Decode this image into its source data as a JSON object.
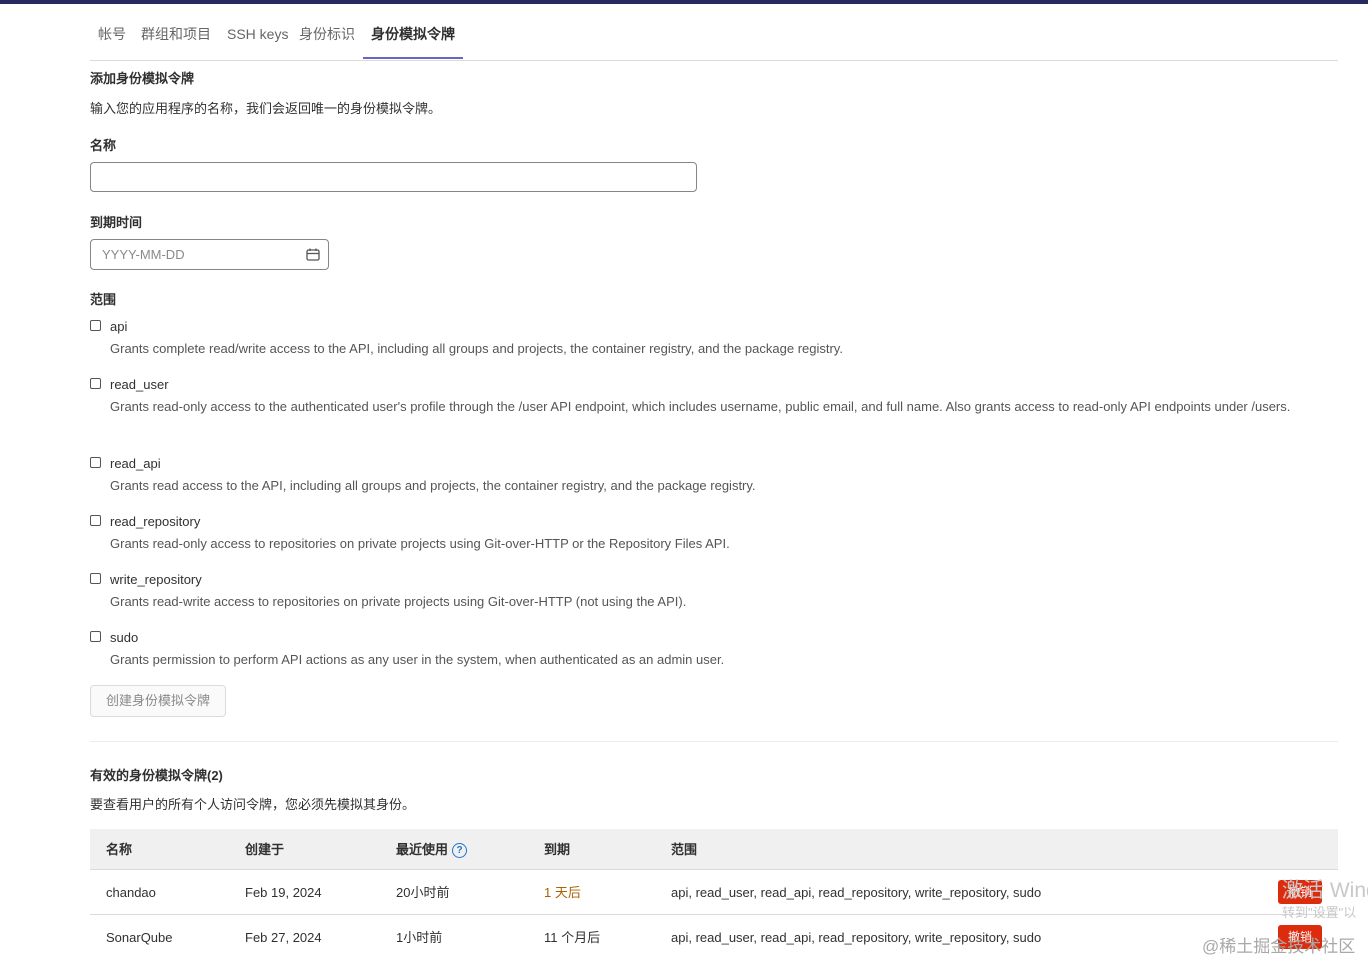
{
  "tabs": [
    {
      "label": "帐号",
      "active": false
    },
    {
      "label": "群组和项目",
      "active": false
    },
    {
      "label": "SSH keys",
      "active": false
    },
    {
      "label": "身份标识",
      "active": false
    },
    {
      "label": "身份模拟令牌",
      "active": true
    }
  ],
  "add_section": {
    "title": "添加身份模拟令牌",
    "description": "输入您的应用程序的名称，我们会返回唯一的身份模拟令牌。",
    "name_label": "名称",
    "name_value": "",
    "expiry_label": "到期时间",
    "expiry_placeholder": "YYYY-MM-DD",
    "calendar_icon": "calendar-icon",
    "scope_label": "范围",
    "create_button": "创建身份模拟令牌"
  },
  "scopes": [
    {
      "name": "api",
      "checked": false,
      "description": "Grants complete read/write access to the API, including all groups and projects, the container registry, and the package registry."
    },
    {
      "name": "read_user",
      "checked": false,
      "description": "Grants read-only access to the authenticated user's profile through the /user API endpoint, which includes username, public email, and full name. Also grants access to read-only API endpoints under /users."
    },
    {
      "name": "read_api",
      "checked": false,
      "description": "Grants read access to the API, including all groups and projects, the container registry, and the package registry."
    },
    {
      "name": "read_repository",
      "checked": false,
      "description": "Grants read-only access to repositories on private projects using Git-over-HTTP or the Repository Files API."
    },
    {
      "name": "write_repository",
      "checked": false,
      "description": "Grants read-write access to repositories on private projects using Git-over-HTTP (not using the API)."
    },
    {
      "name": "sudo",
      "checked": false,
      "description": "Grants permission to perform API actions as any user in the system, when authenticated as an admin user."
    }
  ],
  "active_section": {
    "title": "有效的身份模拟令牌(2)",
    "description": "要查看用户的所有个人访问令牌，您必须先模拟其身份。",
    "columns": {
      "name": "名称",
      "created": "创建于",
      "last_used": "最近使用",
      "expires": "到期",
      "scopes": "范围"
    },
    "help_icon": "question-circle-icon",
    "rows": [
      {
        "name": "chandao",
        "created": "Feb 19, 2024",
        "last_used": "20小时前",
        "expires": "1 天后",
        "expires_warning": true,
        "scopes": "api, read_user, read_api, read_repository, write_repository, sudo",
        "revoke": "撤销"
      },
      {
        "name": "SonarQube",
        "created": "Feb 27, 2024",
        "last_used": "1小时前",
        "expires": "11 个月后",
        "expires_warning": false,
        "scopes": "api, read_user, read_api, read_repository, write_repository, sudo",
        "revoke": "撤销"
      }
    ]
  },
  "overlay": {
    "win_line1": "激活 Wind",
    "win_line2": "转到\"设置\"以",
    "watermark": "@稀土掘金技术社区"
  },
  "colors": {
    "topbar": "#292961",
    "tab_underline": "#6666c4",
    "revoke": "#dd2b0e",
    "warning": "#ab6100",
    "help": "#1f75cb"
  }
}
